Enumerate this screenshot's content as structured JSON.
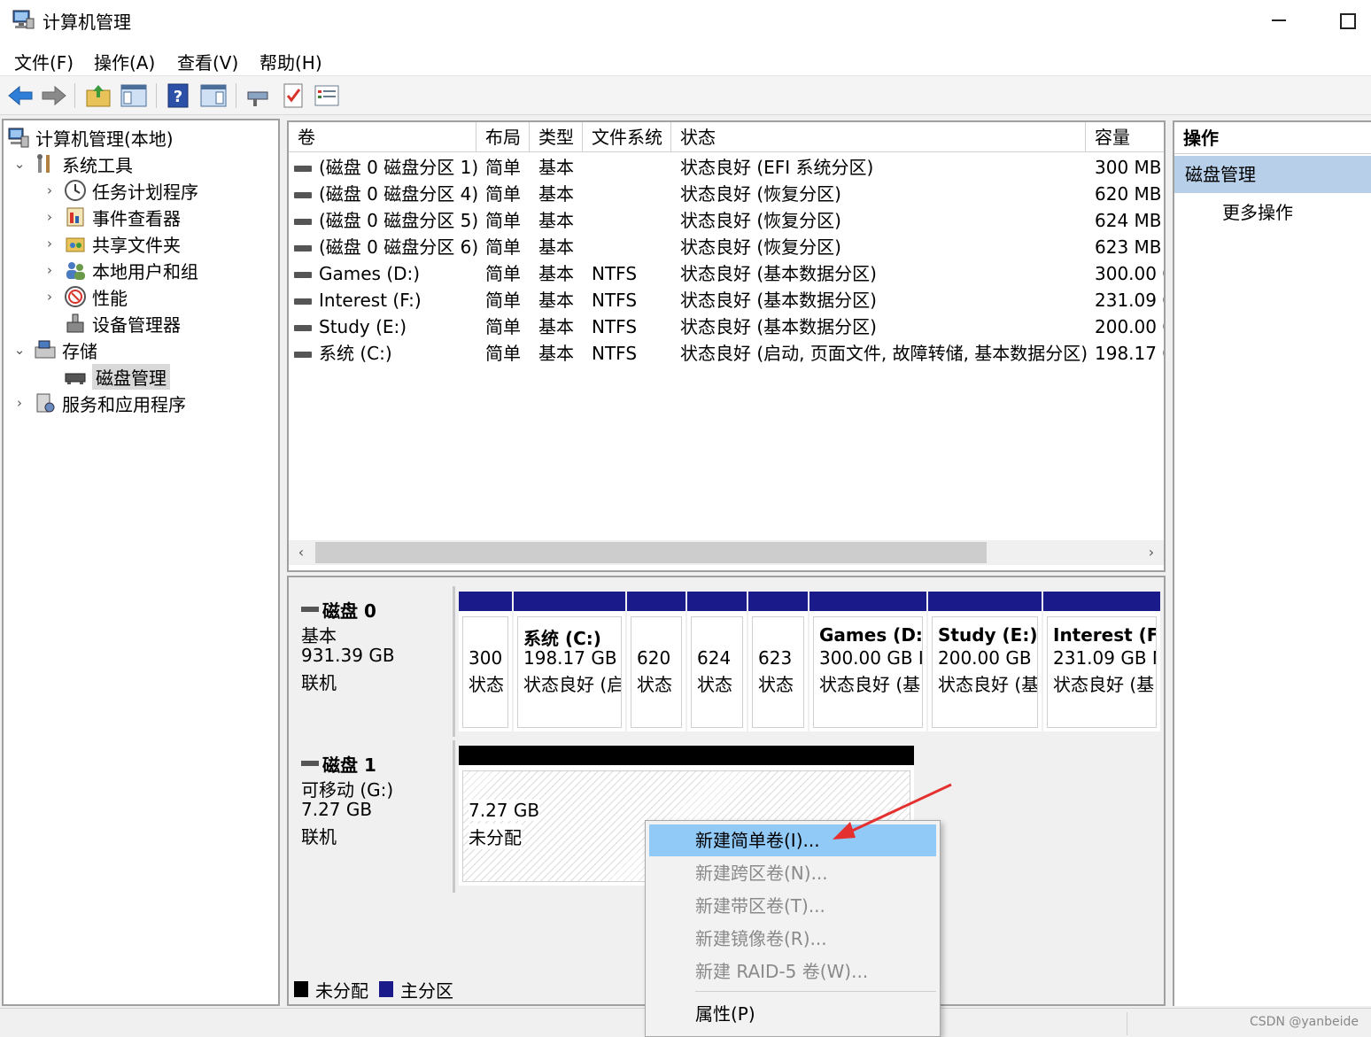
{
  "window": {
    "title": "计算机管理"
  },
  "menu": [
    "文件(F)",
    "操作(A)",
    "查看(V)",
    "帮助(H)"
  ],
  "tree": {
    "root": "计算机管理(本地)",
    "system_tools": "系统工具",
    "task_scheduler": "任务计划程序",
    "event_viewer": "事件查看器",
    "shared_folders": "共享文件夹",
    "local_users": "本地用户和组",
    "performance": "性能",
    "device_manager": "设备管理器",
    "storage": "存储",
    "disk_management": "磁盘管理",
    "services_apps": "服务和应用程序"
  },
  "volume_list": {
    "columns": [
      "卷",
      "布局",
      "类型",
      "文件系统",
      "状态",
      "容量"
    ],
    "rows": [
      [
        "(磁盘 0 磁盘分区 1)",
        "简单",
        "基本",
        "",
        "状态良好 (EFI 系统分区)",
        "300 MB"
      ],
      [
        "(磁盘 0 磁盘分区 4)",
        "简单",
        "基本",
        "",
        "状态良好 (恢复分区)",
        "620 MB"
      ],
      [
        "(磁盘 0 磁盘分区 5)",
        "简单",
        "基本",
        "",
        "状态良好 (恢复分区)",
        "624 MB"
      ],
      [
        "(磁盘 0 磁盘分区 6)",
        "简单",
        "基本",
        "",
        "状态良好 (恢复分区)",
        "623 MB"
      ],
      [
        "Games (D:)",
        "简单",
        "基本",
        "NTFS",
        "状态良好 (基本数据分区)",
        "300.00 G"
      ],
      [
        "Interest (F:)",
        "简单",
        "基本",
        "NTFS",
        "状态良好 (基本数据分区)",
        "231.09 G"
      ],
      [
        "Study (E:)",
        "简单",
        "基本",
        "NTFS",
        "状态良好 (基本数据分区)",
        "200.00 G"
      ],
      [
        "系统 (C:)",
        "简单",
        "基本",
        "NTFS",
        "状态良好 (启动, 页面文件, 故障转储, 基本数据分区)",
        "198.17 G"
      ]
    ]
  },
  "disk0": {
    "name": "磁盘 0",
    "type": "基本",
    "size": "931.39 GB",
    "state": "联机",
    "partitions": [
      {
        "l1": "",
        "l2": "300",
        "l3": "状态"
      },
      {
        "l1": "系统 (C:)",
        "l2": "198.17 GB",
        "l3": "状态良好 (启"
      },
      {
        "l1": "",
        "l2": "620",
        "l3": "状态"
      },
      {
        "l1": "",
        "l2": "624",
        "l3": "状态"
      },
      {
        "l1": "",
        "l2": "623",
        "l3": "状态"
      },
      {
        "l1": "Games (D:",
        "l2": "300.00 GB I",
        "l3": "状态良好 (基"
      },
      {
        "l1": "Study (E:)",
        "l2": "200.00 GB",
        "l3": "状态良好 (基"
      },
      {
        "l1": "Interest (F:",
        "l2": "231.09 GB N",
        "l3": "状态良好 (基"
      }
    ]
  },
  "disk1": {
    "name": "磁盘 1",
    "type": "可移动 (G:)",
    "size": "7.27 GB",
    "state": "联机",
    "partition": {
      "size": "7.27 GB",
      "state": "未分配"
    }
  },
  "legend": {
    "unallocated": "未分配",
    "primary": "主分区"
  },
  "actions": {
    "header": "操作",
    "selected": "磁盘管理",
    "more": "更多操作"
  },
  "context_menu": {
    "new_simple": "新建简单卷(I)...",
    "new_spanned": "新建跨区卷(N)...",
    "new_striped": "新建带区卷(T)...",
    "new_mirrored": "新建镜像卷(R)...",
    "new_raid5": "新建 RAID-5 卷(W)...",
    "properties": "属性(P)"
  },
  "watermark": "CSDN @yanbeide",
  "colors": {
    "primary_partition": "#1a1a8a",
    "unallocated": "#000000",
    "menu_highlight": "#91c9f7",
    "annotation_arrow": "#e53030"
  }
}
